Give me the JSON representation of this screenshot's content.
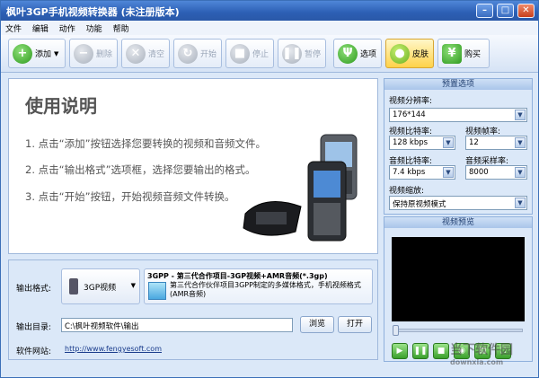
{
  "window": {
    "title": "枫叶3GP手机视频转换器  (未注册版本)"
  },
  "menu": [
    "文件",
    "编辑",
    "动作",
    "功能",
    "帮助"
  ],
  "toolbar": {
    "add": "添加",
    "delete": "删除",
    "clear": "清空",
    "start": "开始",
    "stop": "停止",
    "pause": "暂停",
    "options": "选项",
    "skin": "皮肤",
    "buy": "购买"
  },
  "instructions": {
    "title": "使用说明",
    "steps": [
      "1. 点击“添加”按钮选择您要转换的视频和音频文件。",
      "2. 点击“输出格式”选项框，选择您要输出的格式。",
      "3. 点击“开始”按钮，开始视频音频文件转换。"
    ]
  },
  "output": {
    "format_label": "输出格式:",
    "format_button": "3GP视频",
    "format_title": "3GPP - 第三代合作项目-3GP视频+AMR音频(*.3gp)",
    "format_desc": "第三代合作伙伴项目3GPP制定的多媒体格式，手机视频格式 (AMR音频)",
    "dir_label": "输出目录:",
    "dir_value": "C:\\枫叶视频软件\\输出",
    "browse": "浏览",
    "open": "打开",
    "site_label": "软件网站:",
    "site_url": "http://www.fengyesoft.com"
  },
  "preset": {
    "header": "预置选项",
    "resolution_label": "视频分辨率:",
    "resolution_value": "176*144",
    "vbitrate_label": "视频比特率:",
    "vbitrate_value": "128 kbps",
    "framerate_label": "视频帧率:",
    "framerate_value": "12",
    "abitrate_label": "音频比特率:",
    "abitrate_value": "7.4 kbps",
    "samplerate_label": "音频采样率:",
    "samplerate_value": "8000",
    "scale_label": "视频缩放:",
    "scale_value": "保持原视频模式"
  },
  "preview": {
    "header": "视频预览"
  },
  "watermark": {
    "text": "当下软件园",
    "sub": "downxia.com"
  },
  "colors": {
    "titlebar": "#2c5fb4",
    "panel": "#dbe8f8",
    "accent_green": "#3aa02c",
    "active_yellow": "#ffd24a"
  }
}
